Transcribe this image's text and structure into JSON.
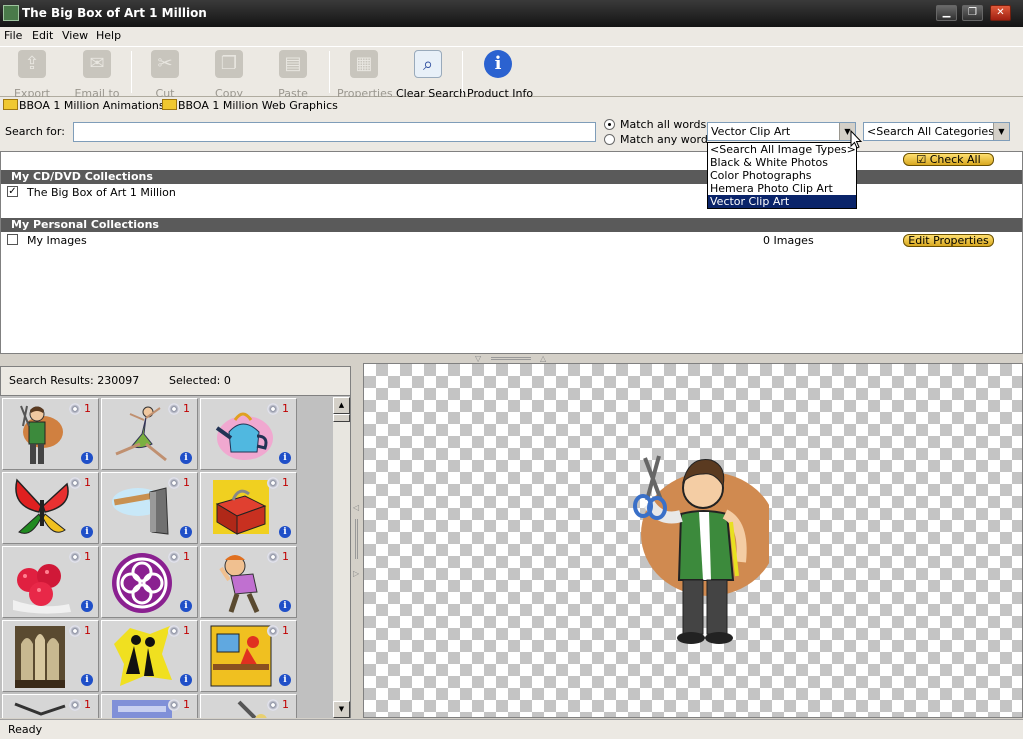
{
  "window": {
    "title": "The Big Box of Art 1 Million"
  },
  "menu": [
    "File",
    "Edit",
    "View",
    "Help"
  ],
  "toolbar": {
    "export": "Export",
    "email": "Email to",
    "cut": "Cut",
    "copy": "Copy",
    "paste": "Paste",
    "properties": "Properties",
    "clear_search": "Clear Search",
    "product_info": "Product Info"
  },
  "links": [
    "BBOA 1 Million Animations",
    "BBOA 1 Million Web Graphics"
  ],
  "search": {
    "label": "Search for:",
    "value": "",
    "match_all": "Match all words",
    "match_any": "Match any word",
    "match_mode": "all",
    "image_type": "Vector Clip Art",
    "category": "<Search All Categories>",
    "type_options": [
      "<Search All Image Types>",
      "Black & White Photos",
      "Color Photographs",
      "Hemera Photo Clip Art",
      "Vector Clip Art"
    ]
  },
  "collections": {
    "check_all": "Check All",
    "cd_header": "My CD/DVD Collections",
    "cd_item": "The Big Box of Art 1 Million",
    "cd_checked": true,
    "personal_header": "My Personal Collections",
    "personal_item": "My Images",
    "personal_count": "0 Images",
    "personal_checked": false,
    "edit_properties": "Edit Properties"
  },
  "results": {
    "label": "Search Results: 230097",
    "selected": "Selected: 0",
    "thumb_count": "1",
    "thumbs": [
      "tailor-with-scissors",
      "ballet-dancer",
      "teapot",
      "butterfly",
      "axe",
      "toolbox",
      "raspberries",
      "celtic-knot",
      "frustrated-man",
      "cathedral-interior",
      "dancing-couple",
      "man-at-computer",
      "partial-1",
      "partial-2",
      "partial-3"
    ]
  },
  "preview": {
    "subject": "tailor-with-scissors"
  },
  "status": "Ready",
  "colors": {
    "title_bar": "#1e1e1e",
    "section_header": "#5a5a5a",
    "selection": "#0a246a",
    "pill_button": "#f0c040"
  }
}
